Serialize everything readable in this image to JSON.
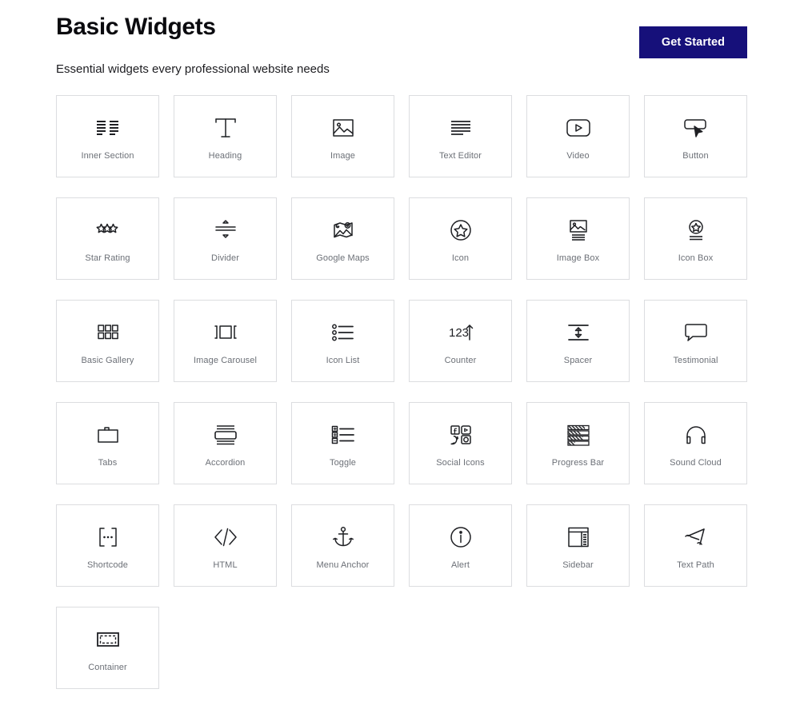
{
  "header": {
    "title": "Basic Widgets",
    "subtitle": "Essential widgets every professional website needs",
    "cta_label": "Get Started",
    "cta_color": "#16107a"
  },
  "theme": {
    "card_border": "#dcdde0",
    "label_color": "#6c7077",
    "icon_color": "#1f2024",
    "background": "#ffffff"
  },
  "grid": {
    "columns": 6,
    "count": 31,
    "widgets": [
      {
        "label": "Inner Section",
        "icon": "inner-section-icon"
      },
      {
        "label": "Heading",
        "icon": "heading-icon"
      },
      {
        "label": "Image",
        "icon": "image-icon"
      },
      {
        "label": "Text Editor",
        "icon": "text-editor-icon"
      },
      {
        "label": "Video",
        "icon": "video-icon"
      },
      {
        "label": "Button",
        "icon": "button-icon"
      },
      {
        "label": "Star Rating",
        "icon": "star-rating-icon"
      },
      {
        "label": "Divider",
        "icon": "divider-icon"
      },
      {
        "label": "Google Maps",
        "icon": "google-maps-icon"
      },
      {
        "label": "Icon",
        "icon": "icon-star-circle-icon"
      },
      {
        "label": "Image Box",
        "icon": "image-box-icon"
      },
      {
        "label": "Icon Box",
        "icon": "icon-box-icon"
      },
      {
        "label": "Basic Gallery",
        "icon": "basic-gallery-icon"
      },
      {
        "label": "Image Carousel",
        "icon": "image-carousel-icon"
      },
      {
        "label": "Icon List",
        "icon": "icon-list-icon"
      },
      {
        "label": "Counter",
        "icon": "counter-icon"
      },
      {
        "label": "Spacer",
        "icon": "spacer-icon"
      },
      {
        "label": "Testimonial",
        "icon": "testimonial-icon"
      },
      {
        "label": "Tabs",
        "icon": "tabs-icon"
      },
      {
        "label": "Accordion",
        "icon": "accordion-icon"
      },
      {
        "label": "Toggle",
        "icon": "toggle-icon"
      },
      {
        "label": "Social Icons",
        "icon": "social-icons-icon"
      },
      {
        "label": "Progress Bar",
        "icon": "progress-bar-icon"
      },
      {
        "label": "Sound Cloud",
        "icon": "sound-cloud-icon"
      },
      {
        "label": "Shortcode",
        "icon": "shortcode-icon"
      },
      {
        "label": "HTML",
        "icon": "html-icon"
      },
      {
        "label": "Menu Anchor",
        "icon": "menu-anchor-icon"
      },
      {
        "label": "Alert",
        "icon": "alert-icon"
      },
      {
        "label": "Sidebar",
        "icon": "sidebar-icon"
      },
      {
        "label": "Text Path",
        "icon": "text-path-icon"
      },
      {
        "label": "Container",
        "icon": "container-icon"
      }
    ]
  }
}
